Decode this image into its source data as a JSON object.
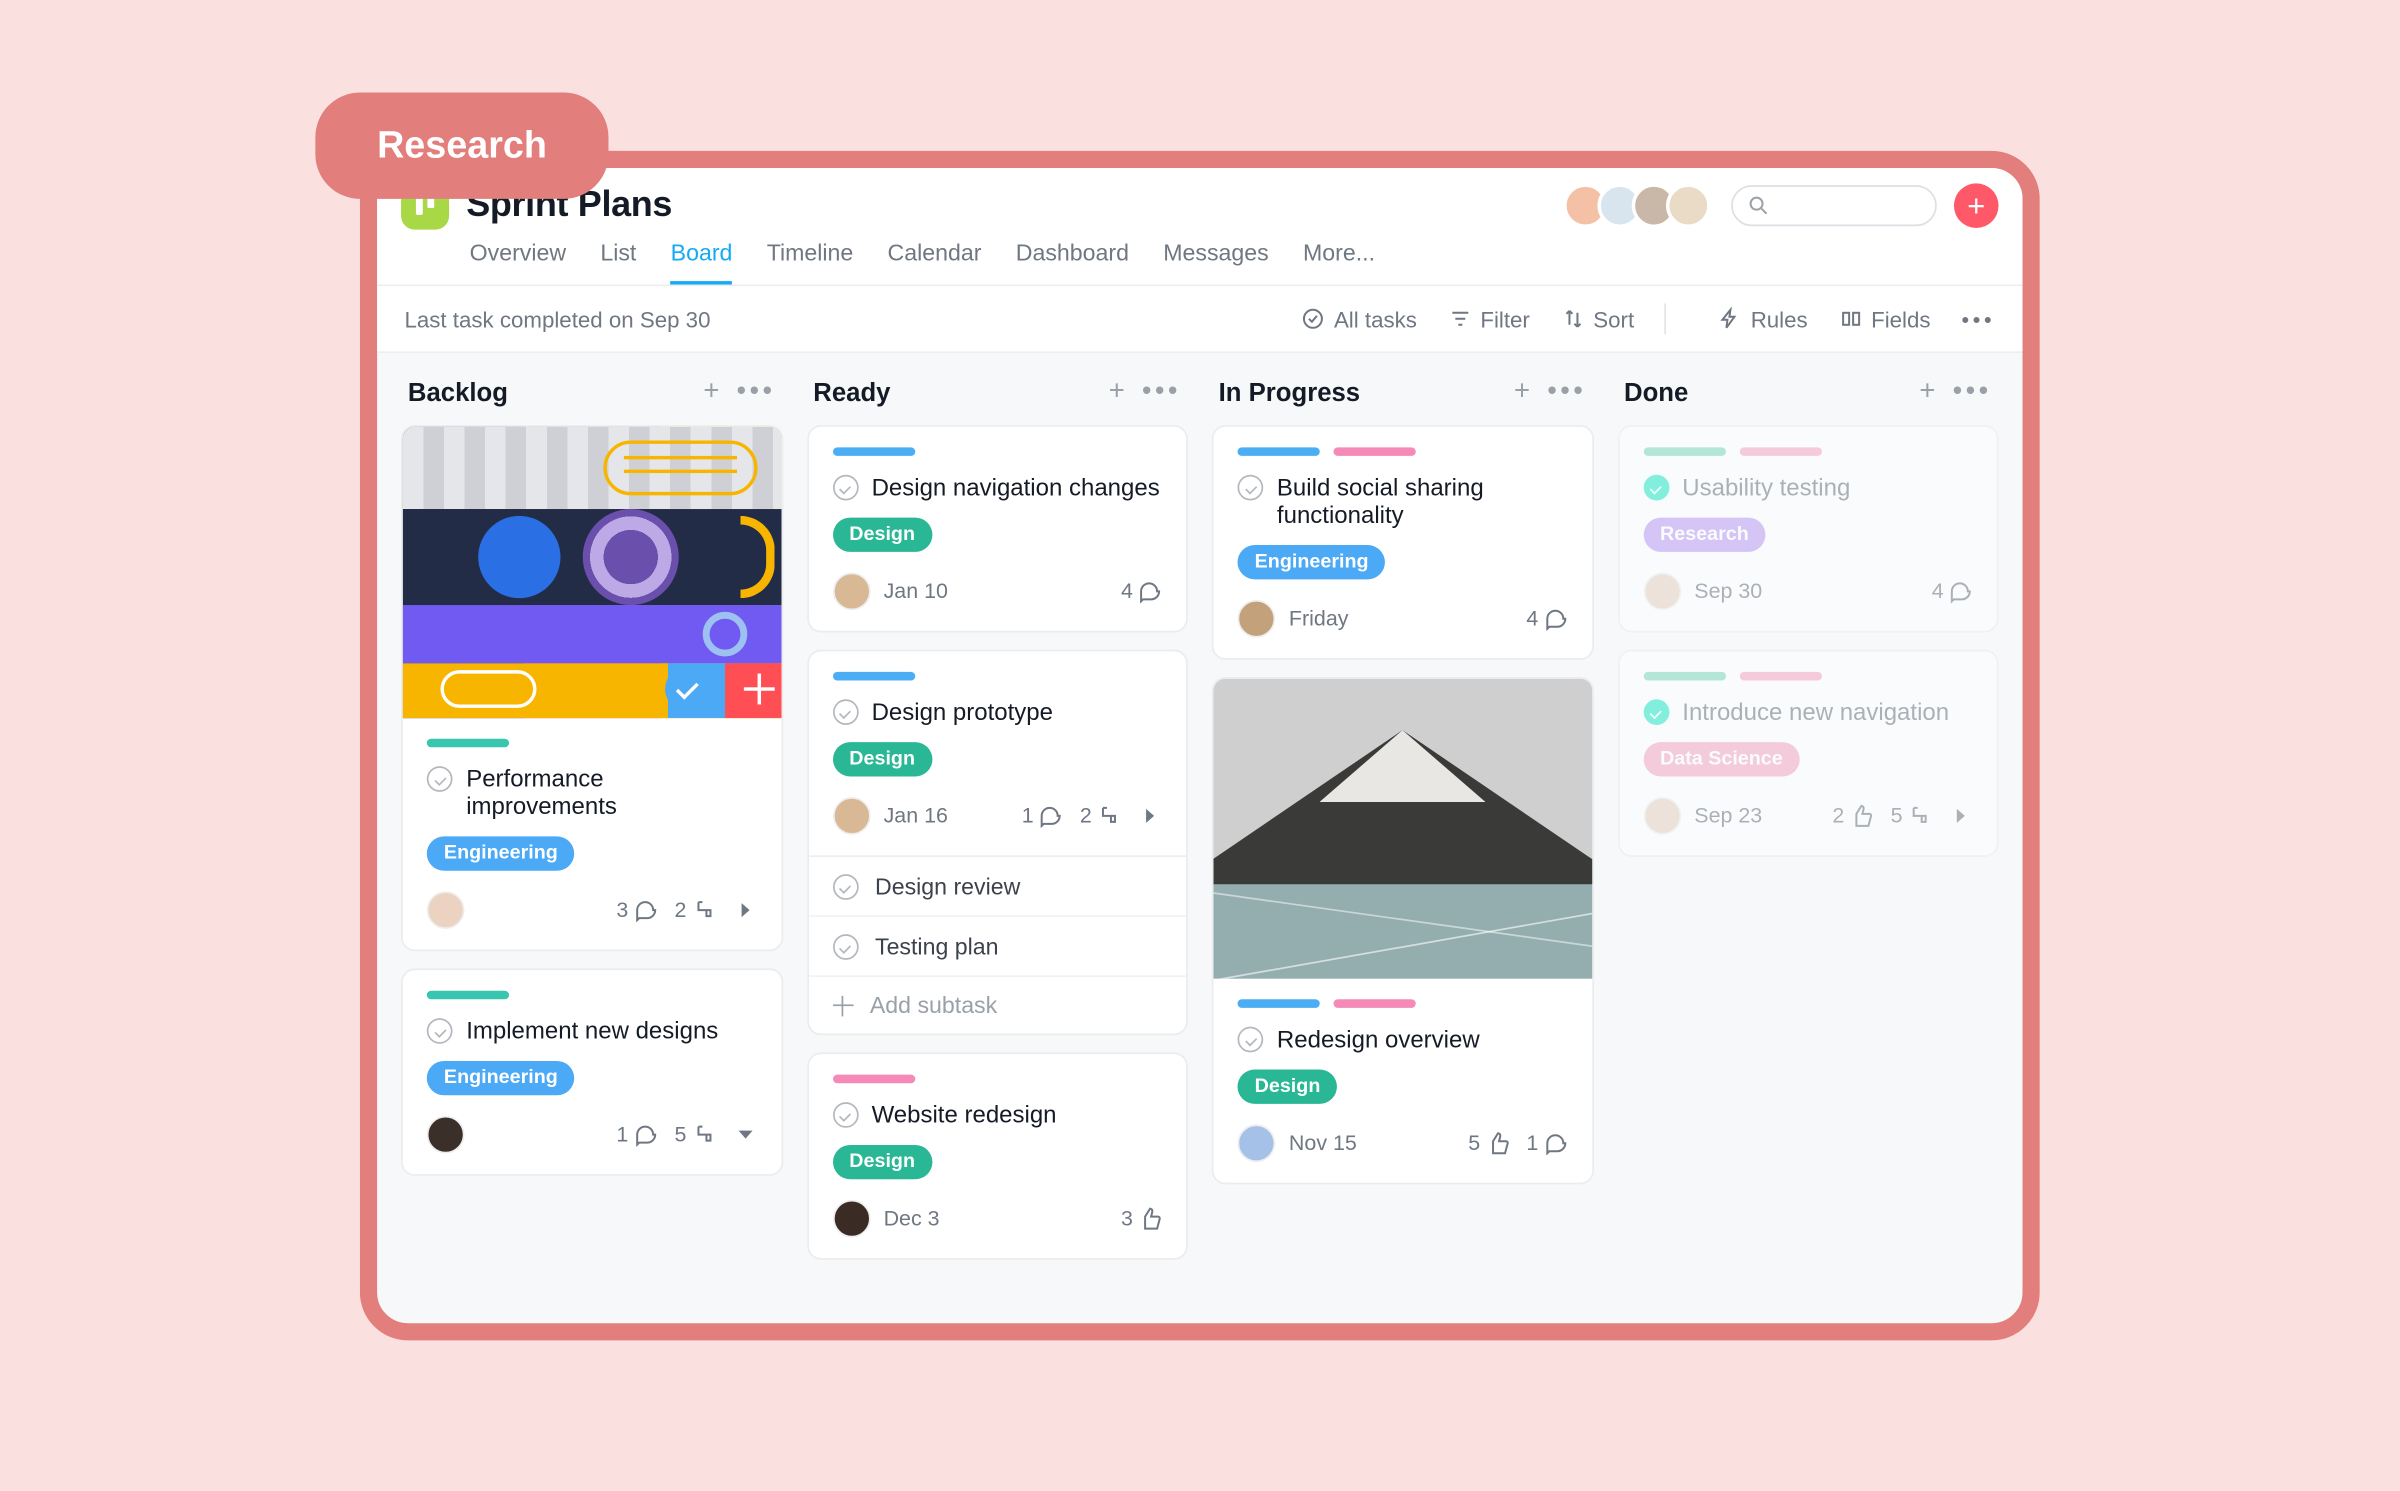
{
  "badge": "Research",
  "project": {
    "title": "Sprint Plans"
  },
  "tabs": [
    "Overview",
    "List",
    "Board",
    "Timeline",
    "Calendar",
    "Dashboard",
    "Messages",
    "More..."
  ],
  "active_tab": "Board",
  "status_bar": "Last task completed on Sep 30",
  "toolbar": {
    "all_tasks": "All tasks",
    "filter": "Filter",
    "sort": "Sort",
    "rules": "Rules",
    "fields": "Fields"
  },
  "columns": {
    "backlog": {
      "title": "Backlog"
    },
    "ready": {
      "title": "Ready"
    },
    "progress": {
      "title": "In Progress"
    },
    "done": {
      "title": "Done"
    }
  },
  "tags": {
    "engineering": "Engineering",
    "design": "Design",
    "research": "Research",
    "data_science": "Data Science"
  },
  "cards": {
    "backlog1": {
      "title": "Performance improvements",
      "tag": "engineering",
      "comments": "3",
      "subtasks": "2"
    },
    "backlog2": {
      "title": "Implement new designs",
      "tag": "engineering",
      "comments": "1",
      "subtasks": "5"
    },
    "ready1": {
      "title": "Design navigation changes",
      "tag": "design",
      "due": "Jan 10",
      "comments": "4"
    },
    "ready2": {
      "title": "Design prototype",
      "tag": "design",
      "due": "Jan 16",
      "comments": "1",
      "subtasks": "2",
      "subs": [
        "Design review",
        "Testing plan"
      ],
      "add_subtask": "Add subtask"
    },
    "ready3": {
      "title": "Website redesign",
      "tag": "design",
      "due": "Dec 3",
      "likes": "3"
    },
    "prog1": {
      "title": "Build social sharing functionality",
      "tag": "engineering",
      "due": "Friday",
      "comments": "4"
    },
    "prog2": {
      "title": "Redesign overview",
      "tag": "design",
      "due": "Nov 15",
      "likes": "5",
      "comments": "1"
    },
    "done1": {
      "title": "Usability testing",
      "tag": "research",
      "due": "Sep 30",
      "comments": "4"
    },
    "done2": {
      "title": "Introduce new navigation",
      "tag": "data_science",
      "due": "Sep 23",
      "likes": "2",
      "subtasks": "5"
    }
  }
}
